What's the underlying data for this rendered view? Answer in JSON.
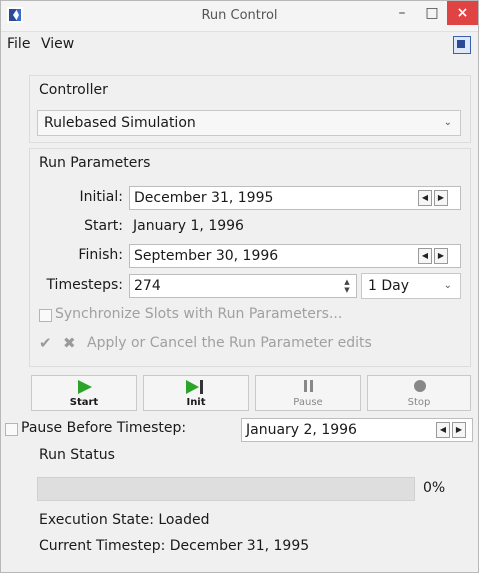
{
  "window": {
    "title": "Run Control",
    "minimize": "–",
    "maximize": "□",
    "close": "×"
  },
  "menu": {
    "file": "File",
    "view": "View"
  },
  "controller": {
    "group_label": "Controller",
    "selected": "Rulebased Simulation"
  },
  "run_parameters": {
    "group_label": "Run Parameters",
    "initial_label": "Initial:",
    "initial_value": "December 31, 1995",
    "start_label": "Start:",
    "start_value": "January 1, 1996",
    "finish_label": "Finish:",
    "finish_value": "September 30, 1996",
    "timesteps_label": "Timesteps:",
    "timesteps_value": "274",
    "timestep_unit": "1 Day",
    "sync_label": "Synchronize Slots with Run Parameters...",
    "apply_cancel_label": "Apply or Cancel the Run Parameter edits"
  },
  "toolbar": {
    "start": "Start",
    "init": "Init",
    "pause": "Pause",
    "stop": "Stop"
  },
  "pause_before": {
    "label": "Pause Before Timestep:",
    "value": "January 2, 1996"
  },
  "run_status": {
    "group_label": "Run Status",
    "progress_percent": 0,
    "progress_text": "0%",
    "execution_state": "Execution State: Loaded",
    "current_timestep": "Current Timestep: December 31, 1995"
  },
  "colors": {
    "accent_green": "#2aa52a",
    "close_red": "#e04343",
    "icon_blue": "#2a4a98"
  }
}
